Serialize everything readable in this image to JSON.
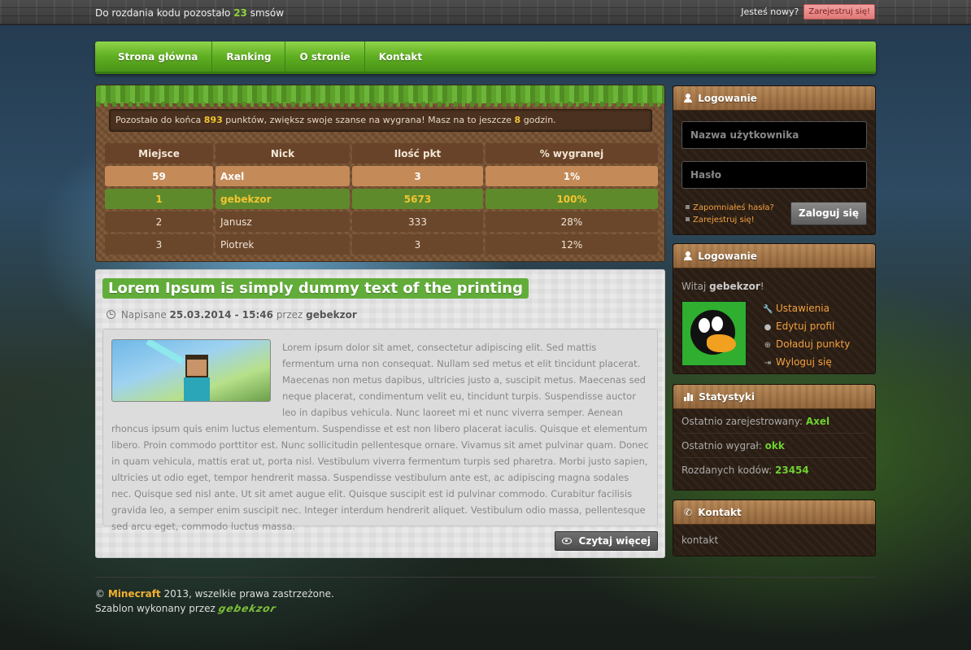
{
  "topbar": {
    "codes_prefix": "Do rozdania kodu pozostało",
    "codes_count": "23",
    "codes_suffix": "smsów",
    "new_question": "Jesteś nowy?",
    "register_label": "Zarejestruj się!"
  },
  "nav": {
    "items": [
      {
        "label": "Strona główna"
      },
      {
        "label": "Ranking"
      },
      {
        "label": "O stronie"
      },
      {
        "label": "Kontakt"
      }
    ]
  },
  "points_info": {
    "prefix": "Pozostało do końca",
    "points": "893",
    "middle": "punktów, zwiększ swoje szanse na wygrana! Masz na to jeszcze",
    "hours": "8",
    "suffix": "godzin."
  },
  "ranking": {
    "headers": [
      "Miejsce",
      "Nick",
      "Ilość pkt",
      "% wygranej"
    ],
    "rows": [
      {
        "place": "59",
        "nick": "Axel",
        "points": "3",
        "percent": "1%"
      },
      {
        "place": "1",
        "nick": "gebekzor",
        "points": "5673",
        "percent": "100%"
      },
      {
        "place": "2",
        "nick": "Janusz",
        "points": "333",
        "percent": "28%"
      },
      {
        "place": "3",
        "nick": "Piotrek",
        "points": "3",
        "percent": "12%"
      }
    ]
  },
  "article": {
    "title": "Lorem Ipsum is simply dummy text of the printing",
    "meta_prefix": "Napisane",
    "date": "25.03.2014 - 15:46",
    "meta_by": "przez",
    "author": "gebekzor",
    "body": "Lorem ipsum dolor sit amet, consectetur adipiscing elit. Sed mattis fermentum urna non consequat. Nullam sed metus et elit tincidunt placerat. Maecenas non metus dapibus, ultricies justo a, suscipit metus. Maecenas sed neque placerat, condimentum velit eu, tincidunt turpis. Suspendisse auctor leo in dapibus vehicula. Nunc laoreet mi et nunc viverra semper. Aenean rhoncus ipsum quis enim luctus elementum. Suspendisse et est non libero placerat iaculis. Quisque et elementum libero. Proin commodo porttitor est. Nunc sollicitudin pellentesque ornare. Vivamus sit amet pulvinar quam. Donec in quam vehicula, mattis erat ut, porta nisl. Vestibulum viverra fermentum turpis sed pharetra. Morbi justo sapien, ultricies ut odio eget, tempor hendrerit massa. Suspendisse vestibulum ante est, ac adipiscing magna sodales nec. Quisque sed nisl ante. Ut sit amet augue elit. Quisque suscipit est id pulvinar commodo. Curabitur facilisis gravida leo, a semper enim suscipit nec. Integer interdum hendrerit aliquet. Vestibulum odio massa, pellentesque sed arcu eget, commodo luctus massa.",
    "read_more": "Czytaj więcej"
  },
  "login_box": {
    "title": "Logowanie",
    "username_placeholder": "Nazwa użytkownika",
    "password_placeholder": "Hasło",
    "forgot_link": "Zapomniałeś hasła?",
    "register_link": "Zarejestruj się!",
    "login_button": "Zaloguj się"
  },
  "user_box": {
    "title": "Logowanie",
    "welcome_prefix": "Witaj",
    "username": "gebekzor",
    "welcome_suffix": "!",
    "menu": [
      {
        "icon": "wrench-icon",
        "label": "Ustawienia"
      },
      {
        "icon": "user-icon",
        "label": "Edytuj profil"
      },
      {
        "icon": "plus-circle-icon",
        "label": "Doładuj punkty"
      },
      {
        "icon": "sign-out-icon",
        "label": "Wyloguj się"
      }
    ]
  },
  "stats_box": {
    "title": "Statystyki",
    "last_registered_label": "Ostatnio zarejestrowany:",
    "last_registered_value": "Axel",
    "last_winner_label": "Ostatnio wygrał:",
    "last_winner_value": "okk",
    "codes_given_label": "Rozdanych kodów:",
    "codes_given_value": "23454"
  },
  "contact_box": {
    "title": "Kontakt",
    "text": "kontakt"
  },
  "footer": {
    "copyright": "©",
    "brand": "Minecraft",
    "rights": "2013, wszelkie prawa zastrzeżone.",
    "template_by": "Szablon wykonany przez",
    "signature": "gebekzor"
  },
  "colors": {
    "accent_green": "#62ad3a",
    "highlight_yellow": "#f2c530",
    "link_orange": "#f2a040",
    "stat_green": "#6ed030"
  }
}
